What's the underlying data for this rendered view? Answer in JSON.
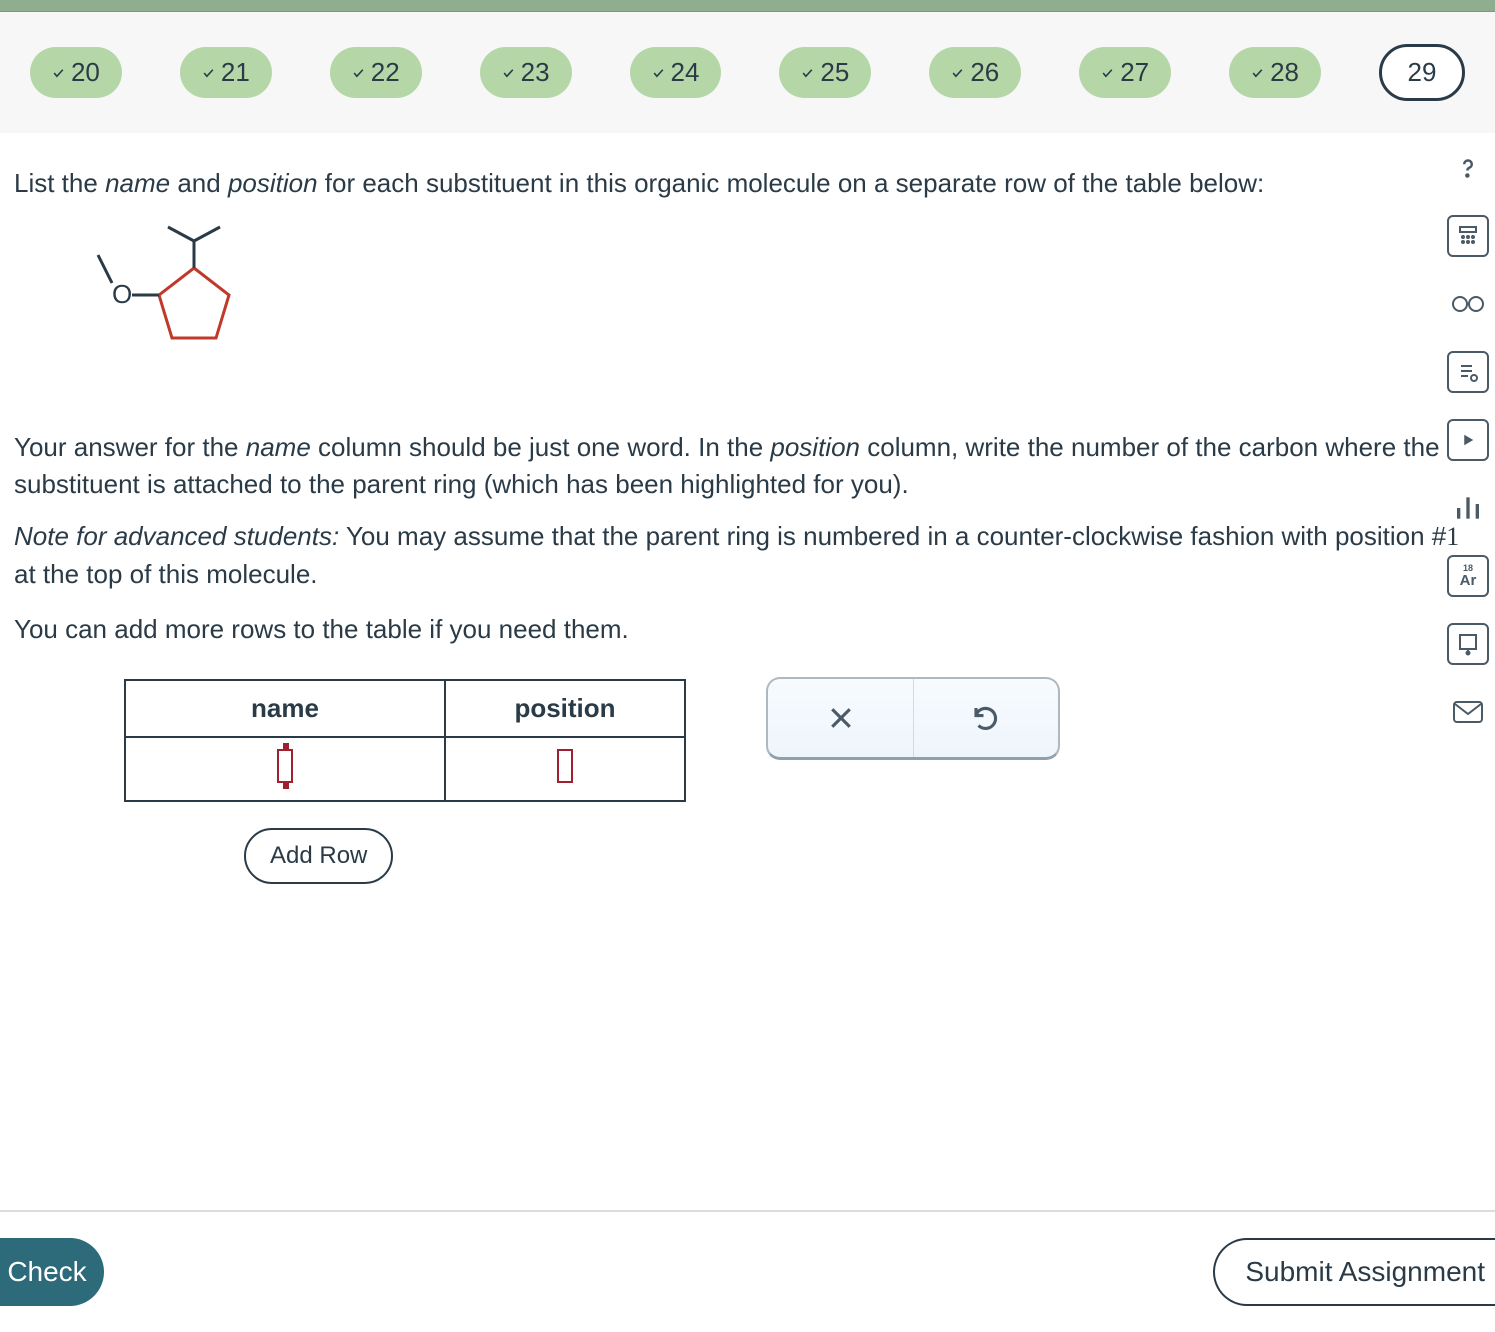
{
  "progress": {
    "items": [
      {
        "n": "20",
        "done": true
      },
      {
        "n": "21",
        "done": true
      },
      {
        "n": "22",
        "done": true
      },
      {
        "n": "23",
        "done": true
      },
      {
        "n": "24",
        "done": true
      },
      {
        "n": "25",
        "done": true
      },
      {
        "n": "26",
        "done": true
      },
      {
        "n": "27",
        "done": true
      },
      {
        "n": "28",
        "done": true
      },
      {
        "n": "29",
        "done": false,
        "current": true
      }
    ]
  },
  "question": {
    "p1_a": "List the ",
    "p1_name": "name",
    "p1_b": " and ",
    "p1_position": "position",
    "p1_c": " for each substituent in this organic molecule on a separate row of the table below:",
    "p2_a": "Your answer for the ",
    "p2_name": "name",
    "p2_b": " column should be just one word. In the ",
    "p2_position": "position",
    "p2_c": " column, write the number of the carbon where the substituent is attached to the parent ring (which has been highlighted for you).",
    "p3_a": "Note for advanced students:",
    "p3_b": " You may assume that the parent ring is numbered in a counter-clockwise fashion with position #",
    "p3_num": "1",
    "p3_c": " at the top of this molecule.",
    "p4": "You can add more rows to the table if you need them."
  },
  "molecule": {
    "oxygen_label": "O"
  },
  "table": {
    "header_name": "name",
    "header_position": "position",
    "add_row": "Add Row"
  },
  "footer": {
    "check": "Check",
    "submit": "Submit Assignment"
  },
  "sidebar": {
    "periodic": "Ar"
  }
}
